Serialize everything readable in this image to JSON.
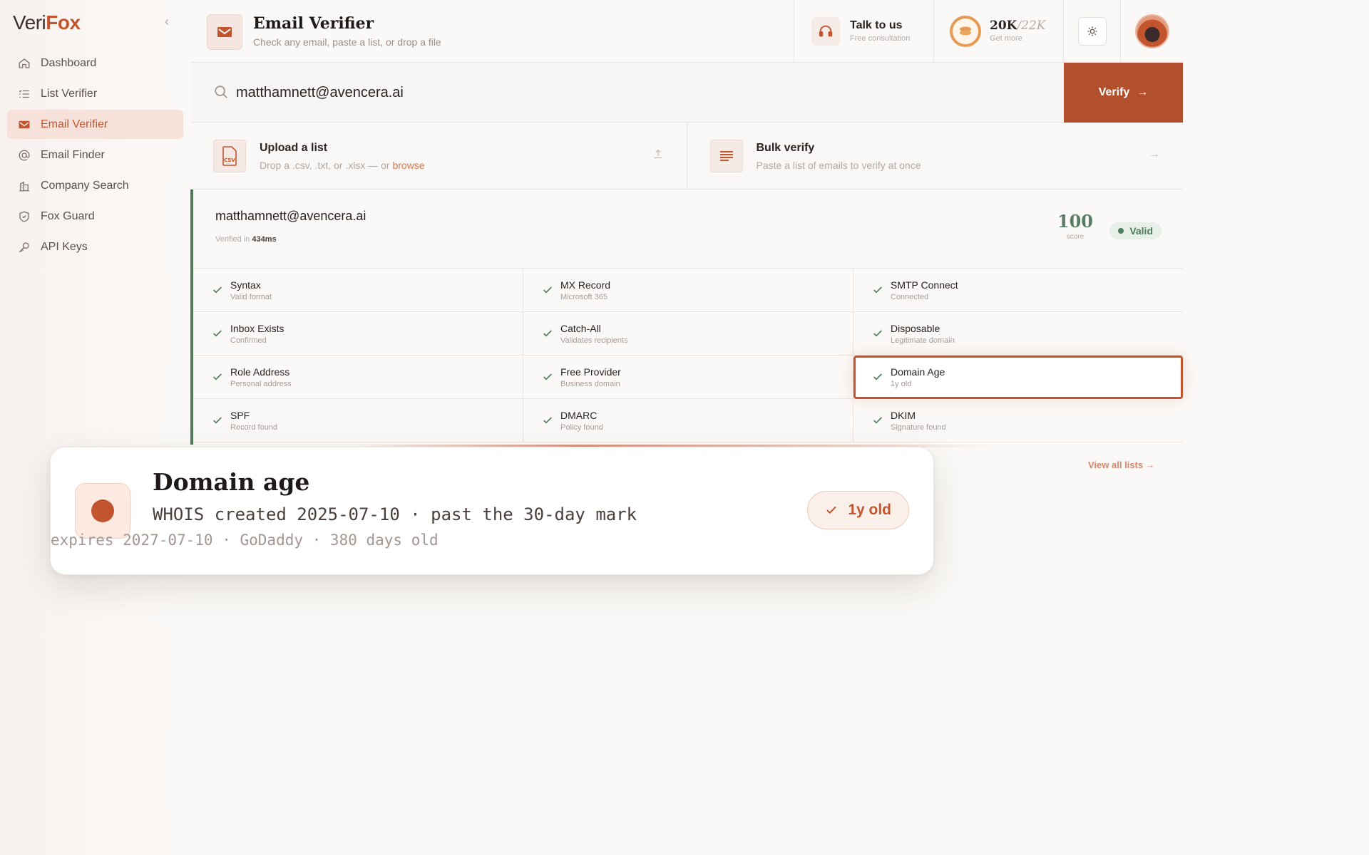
{
  "brand": {
    "prefix": "Veri",
    "suffix": "Fox"
  },
  "sidebar": {
    "items": [
      {
        "label": "Dashboard",
        "icon": "home-icon"
      },
      {
        "label": "List Verifier",
        "icon": "list-icon"
      },
      {
        "label": "Email Verifier",
        "icon": "mail-icon",
        "active": true
      },
      {
        "label": "Email Finder",
        "icon": "at-sign-icon"
      },
      {
        "label": "Company Search",
        "icon": "building-icon"
      },
      {
        "label": "Fox Guard",
        "icon": "shield-check-icon"
      },
      {
        "label": "API Keys",
        "icon": "key-icon"
      }
    ]
  },
  "header": {
    "title": "Email Verifier",
    "subtitle": "Check any email, paste a list, or drop a file",
    "talk": {
      "title": "Talk to us",
      "sub": "Free consultation"
    },
    "credits": {
      "used": "20K",
      "total": "/22K",
      "sub": "Get more"
    }
  },
  "search": {
    "value": "matthamnett@avencera.ai",
    "button": "Verify"
  },
  "actions": {
    "upload": {
      "title": "Upload a list",
      "sub_pre": "Drop a .csv, .txt, or .xlsx — or ",
      "link": "browse",
      "icon_label": "CSV"
    },
    "bulk": {
      "title": "Bulk verify",
      "sub": "Paste a list of emails to verify at once"
    }
  },
  "result": {
    "email": "matthamnett@avencera.ai",
    "verified_prefix": "Verified in",
    "verified_time": "434ms",
    "score": "100",
    "score_label": "score",
    "status": "Valid",
    "checks": [
      {
        "name": "Syntax",
        "sub": "Valid format"
      },
      {
        "name": "MX Record",
        "sub": "Microsoft 365"
      },
      {
        "name": "SMTP Connect",
        "sub": "Connected"
      },
      {
        "name": "Inbox Exists",
        "sub": "Confirmed"
      },
      {
        "name": "Catch-All",
        "sub": "Validates recipients"
      },
      {
        "name": "Disposable",
        "sub": "Legitimate domain"
      },
      {
        "name": "Role Address",
        "sub": "Personal address"
      },
      {
        "name": "Free Provider",
        "sub": "Business domain"
      },
      {
        "name": "Domain Age",
        "sub": "1y old",
        "focus": true
      },
      {
        "name": "SPF",
        "sub": "Record found"
      },
      {
        "name": "DMARC",
        "sub": "Policy found"
      },
      {
        "name": "DKIM",
        "sub": "Signature found"
      }
    ]
  },
  "view_all": "View all lists →",
  "popup": {
    "title": "Domain age",
    "line1": "WHOIS created 2025-07-10 · past the 30-day mark",
    "line2": "expires 2027-07-10 · GoDaddy · 380 days old",
    "badge": "1y old"
  },
  "colors": {
    "accent": "#c2552e",
    "valid": "#4f7a5c",
    "verify_button": "#b24f2d"
  }
}
